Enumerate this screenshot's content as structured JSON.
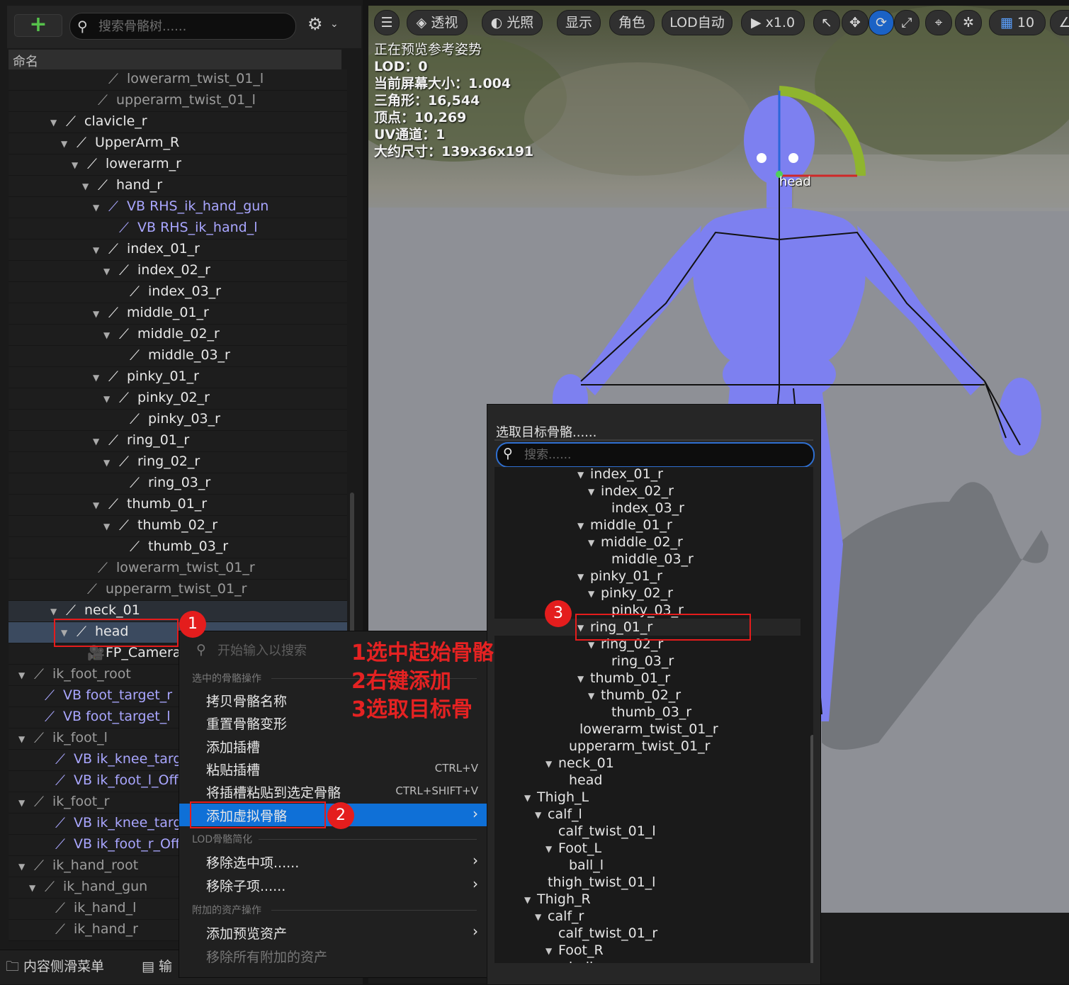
{
  "tree_panel": {
    "search_placeholder": "搜索骨骼树......",
    "column_name": "命名",
    "rows": [
      {
        "label": "lowerarm_twist_01_l",
        "style": "grey"
      },
      {
        "label": "upperarm_twist_01_l",
        "style": "grey"
      },
      {
        "label": "clavicle_r",
        "style": "white"
      },
      {
        "label": "UpperArm_R",
        "style": "white"
      },
      {
        "label": "lowerarm_r",
        "style": "white"
      },
      {
        "label": "hand_r",
        "style": "white"
      },
      {
        "label": "VB RHS_ik_hand_gun",
        "style": "vb"
      },
      {
        "label": "VB RHS_ik_hand_l",
        "style": "vb"
      },
      {
        "label": "index_01_r",
        "style": "white"
      },
      {
        "label": "index_02_r",
        "style": "white"
      },
      {
        "label": "index_03_r",
        "style": "white"
      },
      {
        "label": "middle_01_r",
        "style": "white"
      },
      {
        "label": "middle_02_r",
        "style": "white"
      },
      {
        "label": "middle_03_r",
        "style": "white"
      },
      {
        "label": "pinky_01_r",
        "style": "white"
      },
      {
        "label": "pinky_02_r",
        "style": "white"
      },
      {
        "label": "pinky_03_r",
        "style": "white"
      },
      {
        "label": "ring_01_r",
        "style": "white"
      },
      {
        "label": "ring_02_r",
        "style": "white"
      },
      {
        "label": "ring_03_r",
        "style": "white"
      },
      {
        "label": "thumb_01_r",
        "style": "white"
      },
      {
        "label": "thumb_02_r",
        "style": "white"
      },
      {
        "label": "thumb_03_r",
        "style": "white"
      },
      {
        "label": "lowerarm_twist_01_r",
        "style": "grey"
      },
      {
        "label": "upperarm_twist_01_r",
        "style": "grey"
      },
      {
        "label": "neck_01",
        "style": "white"
      },
      {
        "label": "head",
        "style": "white"
      },
      {
        "label": "FP_Camera",
        "style": "white"
      },
      {
        "label": "ik_foot_root",
        "style": "grey"
      },
      {
        "label": "VB foot_target_r",
        "style": "vb"
      },
      {
        "label": "VB foot_target_l",
        "style": "vb"
      },
      {
        "label": "ik_foot_l",
        "style": "grey"
      },
      {
        "label": "VB ik_knee_target_l",
        "style": "vb"
      },
      {
        "label": "VB ik_foot_l_Offset",
        "style": "vb"
      },
      {
        "label": "ik_foot_r",
        "style": "grey"
      },
      {
        "label": "VB ik_knee_target_r",
        "style": "vb"
      },
      {
        "label": "VB ik_foot_r_Offset",
        "style": "vb"
      },
      {
        "label": "ik_hand_root",
        "style": "grey"
      },
      {
        "label": "ik_hand_gun",
        "style": "grey"
      },
      {
        "label": "ik_hand_l",
        "style": "grey"
      },
      {
        "label": "ik_hand_r",
        "style": "grey"
      }
    ]
  },
  "bottom_tabs": {
    "content_drawer": "内容侧滑菜单",
    "output": "输"
  },
  "viewport": {
    "toolbar": {
      "perspective": "透视",
      "lighting": "光照",
      "show": "显示",
      "character": "角色",
      "lod": "LOD自动",
      "speed": "x1.0",
      "grid_value": "10"
    },
    "stats": {
      "preview_mode": "正在预览参考姿势",
      "lod": "LOD：0",
      "screen_size": "当前屏幕大小：1.004",
      "triangles": "三角形：16,544",
      "vertices": "顶点：10,269",
      "uv_channels": "UV通道：1",
      "approx_size": "大约尺寸：139x36x191"
    },
    "bone_label": "head"
  },
  "context_menu": {
    "search_placeholder": "开始输入以搜索",
    "section_selected": "选中的骨骼操作",
    "items_a": [
      {
        "label": "拷贝骨骼名称",
        "shortcut": ""
      },
      {
        "label": "重置骨骼变形",
        "shortcut": ""
      },
      {
        "label": "添加插槽",
        "shortcut": ""
      },
      {
        "label": "粘贴插槽",
        "shortcut": "CTRL+V"
      },
      {
        "label": "将插槽粘贴到选定骨骼",
        "shortcut": "CTRL+SHIFT+V"
      },
      {
        "label": "添加虚拟骨骼",
        "shortcut": ""
      }
    ],
    "section_lod": "LOD骨骼简化",
    "items_b": [
      {
        "label": "移除选中项......"
      },
      {
        "label": "移除子项......"
      }
    ],
    "section_assets": "附加的资产操作",
    "items_c": [
      {
        "label": "添加预览资产"
      },
      {
        "label": "移除所有附加的资产"
      }
    ]
  },
  "picker": {
    "title": "选取目标骨骼......",
    "search_placeholder": "搜索......",
    "rows": [
      {
        "label": "index_01_r",
        "arrow": true
      },
      {
        "label": "index_02_r",
        "arrow": true
      },
      {
        "label": "index_03_r",
        "arrow": false
      },
      {
        "label": "middle_01_r",
        "arrow": true
      },
      {
        "label": "middle_02_r",
        "arrow": true
      },
      {
        "label": "middle_03_r",
        "arrow": false
      },
      {
        "label": "pinky_01_r",
        "arrow": true
      },
      {
        "label": "pinky_02_r",
        "arrow": true
      },
      {
        "label": "pinky_03_r",
        "arrow": false
      },
      {
        "label": "ring_01_r",
        "arrow": true
      },
      {
        "label": "ring_02_r",
        "arrow": true
      },
      {
        "label": "ring_03_r",
        "arrow": false
      },
      {
        "label": "thumb_01_r",
        "arrow": true
      },
      {
        "label": "thumb_02_r",
        "arrow": true
      },
      {
        "label": "thumb_03_r",
        "arrow": false
      },
      {
        "label": "lowerarm_twist_01_r",
        "arrow": false
      },
      {
        "label": "upperarm_twist_01_r",
        "arrow": false
      },
      {
        "label": "neck_01",
        "arrow": true
      },
      {
        "label": "head",
        "arrow": false
      },
      {
        "label": "Thigh_L",
        "arrow": true
      },
      {
        "label": "calf_l",
        "arrow": true
      },
      {
        "label": "calf_twist_01_l",
        "arrow": false
      },
      {
        "label": "Foot_L",
        "arrow": true
      },
      {
        "label": "ball_l",
        "arrow": false
      },
      {
        "label": "thigh_twist_01_l",
        "arrow": false
      },
      {
        "label": "Thigh_R",
        "arrow": true
      },
      {
        "label": "calf_r",
        "arrow": true
      },
      {
        "label": "calf_twist_01_r",
        "arrow": false
      },
      {
        "label": "Foot_R",
        "arrow": true
      },
      {
        "label": "ball_r",
        "arrow": false
      }
    ]
  },
  "annotations": {
    "badge1": "1",
    "badge2": "2",
    "badge3": "3",
    "step1": "1选中起始骨骼",
    "step2": "2右键添加",
    "step3": "3选取目标骨"
  },
  "colors": {
    "accent_blue": "#0f70d7",
    "annotation_red": "#e51c1c",
    "virtual_bone": "#a9a6ff",
    "mannequin": "#7d80f0"
  }
}
